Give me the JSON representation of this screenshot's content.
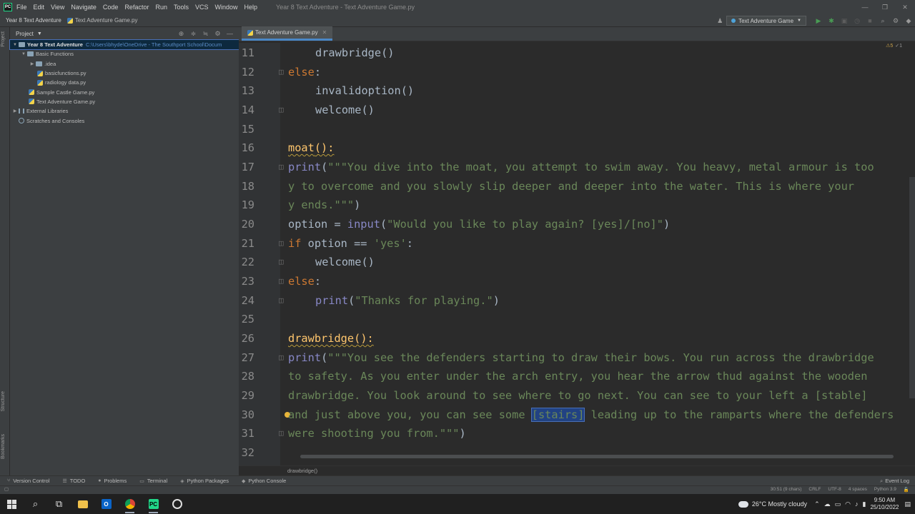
{
  "title_bar": {
    "menu": [
      "File",
      "Edit",
      "View",
      "Navigate",
      "Code",
      "Refactor",
      "Run",
      "Tools",
      "VCS",
      "Window",
      "Help"
    ],
    "window_title": "Year 8 Text Adventure - Text Adventure Game.py"
  },
  "nav_bar": {
    "project": "Year 8 Text Adventure",
    "file": "Text Adventure Game.py",
    "run_config": "Text Adventure Game"
  },
  "project_panel": {
    "label": "Project",
    "root": {
      "name": "Year 8 Text Adventure",
      "path": "C:\\Users\\bhyde\\OneDrive - The Southport School\\Docum"
    },
    "items": [
      {
        "name": "Basic Functions",
        "kind": "folder"
      },
      {
        "name": ".idea",
        "kind": "folder"
      },
      {
        "name": "basicfunctions.py",
        "kind": "python"
      },
      {
        "name": "radiology data.py",
        "kind": "python"
      },
      {
        "name": "Sample Castle Game.py",
        "kind": "python"
      },
      {
        "name": "Text Adventure Game.py",
        "kind": "python"
      },
      {
        "name": "External Libraries",
        "kind": "library"
      },
      {
        "name": "Scratches and Consoles",
        "kind": "scratch"
      }
    ]
  },
  "left_strip": {
    "top": "Project",
    "mid": "Structure",
    "bottom": "Bookmarks"
  },
  "editor": {
    "tab": "Text Adventure Game.py",
    "inspections": {
      "warnings": "⚠5",
      "ok": "✓1"
    },
    "line_numbers": [
      "11",
      "12",
      "13",
      "14",
      "15",
      "16",
      "17",
      "18",
      "19",
      "20",
      "21",
      "22",
      "23",
      "24",
      "25",
      "26",
      "27",
      "28",
      "29",
      "30",
      "31",
      "32"
    ],
    "breadcrumb": "drawbridge()",
    "code": {
      "l11": "drawbridge()",
      "l12_kw": "else",
      "l12_rest": ":",
      "l13": "invalidoption()",
      "l14": "welcome()",
      "l16_name": "moat",
      "l16_rest": "():",
      "l17_fn": "print",
      "l17_paren": "(",
      "l17_str": "\"\"\"You dive into the moat, you attempt to swim away. You heavy, metal armour is too",
      "l18_str": "y to overcome and you slowly slip deeper and deeper into the water. This is where your",
      "l19_str": "y ends.\"\"\"",
      "l19_paren": ")",
      "l20_var": "option = ",
      "l20_fn": "input",
      "l20_paren": "(",
      "l20_str": "\"Would you like to play again? [yes]/[no]\"",
      "l20_close": ")",
      "l21_kw": "if",
      "l21_mid": " option == ",
      "l21_str": "'yes'",
      "l21_end": ":",
      "l22": "welcome()",
      "l23_kw": "else",
      "l23_rest": ":",
      "l24_fn": "print",
      "l24_paren": "(",
      "l24_str": "\"Thanks for playing.\"",
      "l24_close": ")",
      "l26_name": "drawbridge",
      "l26_rest": "():",
      "l27_fn": "print",
      "l27_paren": "(",
      "l27_str": "\"\"\"You see the defenders starting to draw their bows. You run across the drawbridge",
      "l28_str": "to safety. As you enter under the arch entry, you hear the arrow thud against the wooden",
      "l29_str": "drawbridge. You look around to see where to go next. You can see to your left a [stable]",
      "l30_a": "and just above you, you can see some ",
      "l30_sel": "[stairs]",
      "l30_b": " leading up to the ramparts where the defenders",
      "l31_str": "were shooting you from.\"\"\"",
      "l31_paren": ")"
    }
  },
  "tool_windows": [
    "Version Control",
    "TODO",
    "Problems",
    "Terminal",
    "Python Packages",
    "Python Console"
  ],
  "event_log": "Event Log",
  "status_bar": {
    "position": "30:51 (9 chars)",
    "line_sep": "CRLF",
    "encoding": "UTF-8",
    "indent": "4 spaces",
    "interpreter": "Python 3.9"
  },
  "taskbar": {
    "weather": "26°C  Mostly cloudy",
    "time": "9:50 AM",
    "date": "25/10/2022"
  },
  "colors": {
    "keyword": "#cc7832",
    "string": "#6a8759",
    "definition": "#ffc66d",
    "builtin": "#8888c6",
    "selection": "#214283"
  }
}
